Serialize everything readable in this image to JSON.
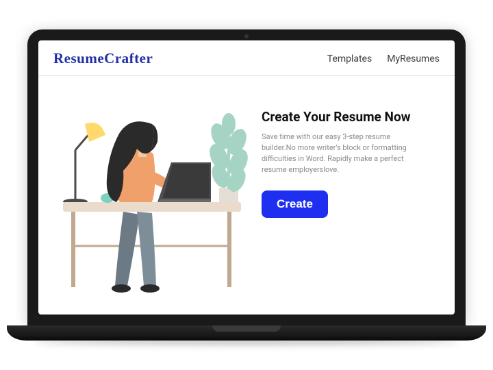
{
  "brand": "ResumeCrafter",
  "nav": {
    "templates": "Templates",
    "myresumes": "MyResumes"
  },
  "hero": {
    "headline": "Create Your Resume Now",
    "subtext": "Save time with our easy 3-step resume builder.No more writer's block or formatting difficulties in Word. Rapidly make a perfect resume employerslove.",
    "cta_label": "Create"
  },
  "colors": {
    "brand_blue": "#1f2ea7",
    "cta_blue": "#1f2ff0"
  }
}
